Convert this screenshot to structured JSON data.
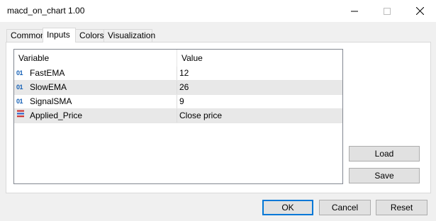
{
  "window": {
    "title": "macd_on_chart 1.00"
  },
  "tabs": [
    {
      "label": "Common"
    },
    {
      "label": "Inputs"
    },
    {
      "label": "Colors"
    },
    {
      "label": "Visualization"
    }
  ],
  "table": {
    "headers": {
      "variable": "Variable",
      "value": "Value"
    },
    "rows": [
      {
        "icon": "01",
        "name": "FastEMA",
        "value": "12"
      },
      {
        "icon": "01",
        "name": "SlowEMA",
        "value": "26"
      },
      {
        "icon": "01",
        "name": "SignalSMA",
        "value": "9"
      },
      {
        "icon": "enum-icon",
        "name": "Applied_Price",
        "value": "Close price"
      }
    ]
  },
  "buttons": {
    "load": "Load",
    "save": "Save",
    "ok": "OK",
    "cancel": "Cancel",
    "reset": "Reset"
  },
  "colors": {
    "accent": "#0078d7",
    "int_icon": "#1560b6"
  }
}
